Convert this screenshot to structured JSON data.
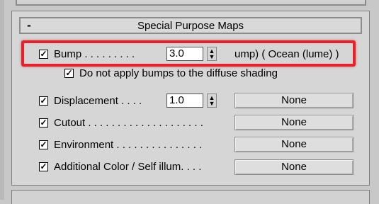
{
  "rollout": {
    "collapse_symbol": "-",
    "title": "Special Purpose Maps"
  },
  "bump": {
    "checked": true,
    "label": "Bump . . . . . . . . .",
    "value": "3.0",
    "map_text": "ump) ( Ocean (lume) )"
  },
  "no_diffuse_bump": {
    "checked": true,
    "label": "Do not apply bumps to the diffuse shading"
  },
  "maps": [
    {
      "label": "Displacement . . . .",
      "checked": true,
      "value": "1.0",
      "button": "None"
    },
    {
      "label": "Cutout . . . . . . . . . . . . . . . . . . . .",
      "checked": true,
      "button": "None"
    },
    {
      "label": "Environment . . . . . . . . . . . . . . .",
      "checked": true,
      "button": "None"
    },
    {
      "label": "Additional Color / Self illum. . . .",
      "checked": true,
      "button": "None"
    }
  ],
  "icons": {
    "checkbox_mark": "✓",
    "spinner": "spinner-arrows-icon"
  },
  "colors": {
    "highlight": "#e8202a",
    "panel": "#d6d6d6"
  }
}
